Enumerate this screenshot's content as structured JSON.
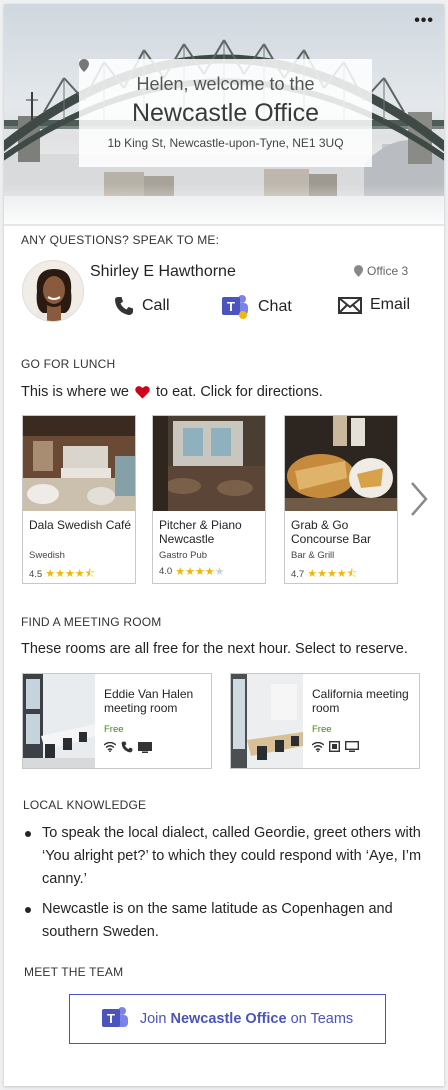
{
  "hero": {
    "more_label": "•••",
    "greeting": "Helen, welcome to the",
    "office_name": "Newcastle Office",
    "address": "1b King St, Newcastle-upon-Tyne, NE1 3UQ"
  },
  "contact": {
    "heading": "ANY QUESTIONS? SPEAK TO ME:",
    "name": "Shirley E Hawthorne",
    "office": "Office 3",
    "actions": {
      "call": "Call",
      "chat": "Chat",
      "email": "Email"
    }
  },
  "lunch": {
    "heading": "GO FOR LUNCH",
    "intro_before": "This is where we",
    "intro_after": "to eat. Click for directions.",
    "places": [
      {
        "name": "Dala Swedish Café",
        "type": "Swedish",
        "rating": "4.5",
        "stars": 4.5
      },
      {
        "name": "Pitcher & Piano Newcastle",
        "type": "Gastro Pub",
        "rating": "4.0",
        "stars": 4.0
      },
      {
        "name": "Grab & Go Concourse Bar",
        "type": "Bar & Grill",
        "rating": "4.7",
        "stars": 4.7
      }
    ]
  },
  "rooms": {
    "heading": "FIND A MEETING ROOM",
    "intro": "These rooms are all free for the next hour. Select to reserve.",
    "items": [
      {
        "name": "Eddie Van Halen meeting room",
        "status": "Free"
      },
      {
        "name": "California meeting room",
        "status": "Free"
      }
    ]
  },
  "knowledge": {
    "heading": "LOCAL KNOWLEDGE",
    "items": [
      "To speak the local dialect, called Geordie, greet others with ‘You alright pet?’ to which they could respond with ‘Aye, I’m canny.’",
      "Newcastle is on the same latitude as Copenhagen and southern Sweden."
    ]
  },
  "team": {
    "heading": "MEET THE TEAM",
    "join_prefix": "Join",
    "join_office": "Newcastle Office",
    "join_suffix": "on Teams"
  },
  "colors": {
    "teams_purple": "#4b53bc",
    "free_green": "#3a8a10",
    "star_gold": "#f2b705",
    "heart_red": "#d0021b"
  }
}
